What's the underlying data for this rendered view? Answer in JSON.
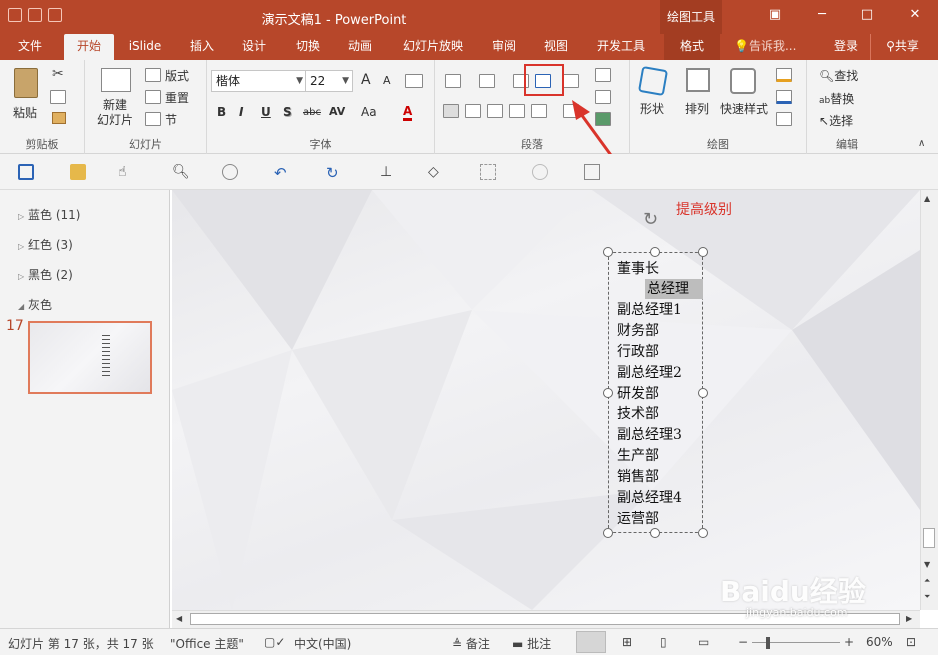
{
  "window": {
    "title": "演示文稿1 - PowerPoint",
    "tool_context": "绘图工具"
  },
  "tabs": [
    "文件",
    "开始",
    "iSlide",
    "插入",
    "设计",
    "切换",
    "动画",
    "幻灯片放映",
    "审阅",
    "视图",
    "开发工具",
    "格式"
  ],
  "tell_me": "告诉我...",
  "login": "登录",
  "share": "共享",
  "ribbon": {
    "clipboard": {
      "label": "剪贴板",
      "paste": "粘贴"
    },
    "slides": {
      "label": "幻灯片",
      "new_slide": "新建\n幻灯片",
      "layout": "版式",
      "reset": "重置",
      "section": "节"
    },
    "font": {
      "label": "字体",
      "font_name": "楷体",
      "font_size": "22",
      "bold": "B",
      "italic": "I",
      "underline": "U",
      "shadow": "S",
      "strike": "abc",
      "spacing": "AV",
      "case": "Aa",
      "color": "A",
      "grow": "A",
      "shrink": "A"
    },
    "paragraph": {
      "label": "段落"
    },
    "drawing": {
      "label": "绘图",
      "shapes": "形状",
      "arrange": "排列",
      "quick_styles": "快速样式"
    },
    "editing": {
      "label": "编辑",
      "find": "查找",
      "replace": "替换",
      "select": "选择"
    }
  },
  "sections": [
    {
      "name": "蓝色 (11)"
    },
    {
      "name": "红色 (3)"
    },
    {
      "name": "黑色 (2)"
    },
    {
      "name": "灰色"
    }
  ],
  "slide_number": "17",
  "textbox_lines": [
    "董事长",
    "总经理",
    "副总经理1",
    "财务部",
    "行政部",
    "副总经理2",
    "研发部",
    "技术部",
    "副总经理3",
    "生产部",
    "销售部",
    "副总经理4",
    "运营部"
  ],
  "callout": "提高级别",
  "status": {
    "slide_info": "幻灯片 第 17 张，共 17 张",
    "theme": "\"Office 主题\"",
    "language": "中文(中国)",
    "notes": "备注",
    "comments": "批注",
    "zoom": "60%"
  },
  "watermark": {
    "brand": "Baidu经验",
    "url": "jingyan.baidu.com"
  },
  "colors": {
    "accent": "#b7472a",
    "highlight": "#d9342b"
  }
}
